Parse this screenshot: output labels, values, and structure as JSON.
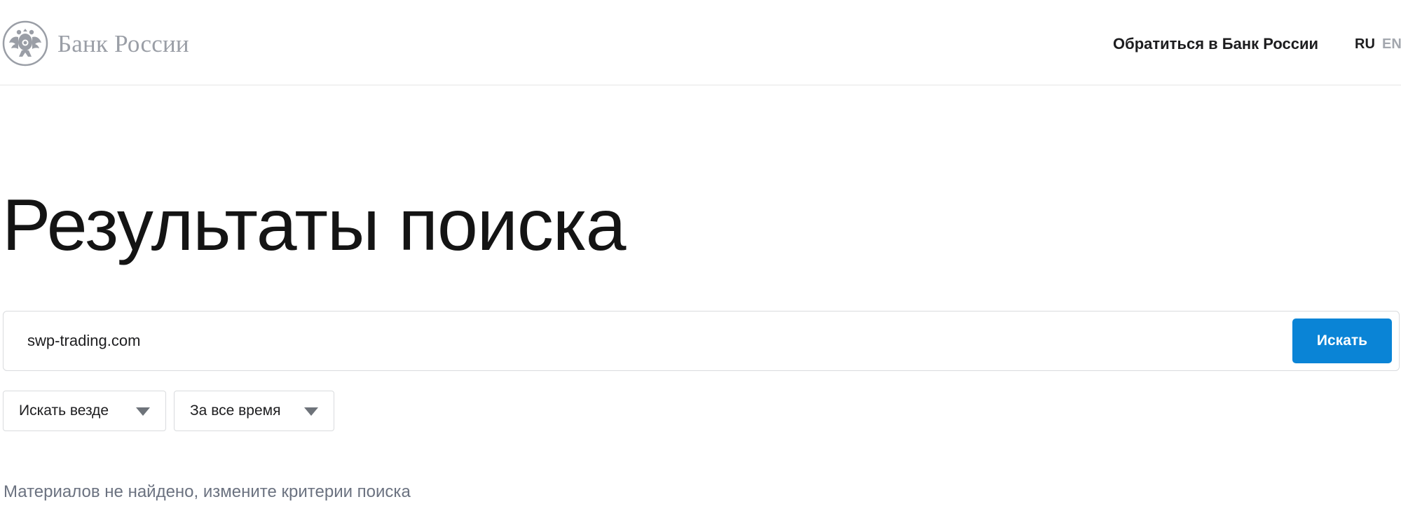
{
  "header": {
    "logo_text": "Банк России",
    "contact_label": "Обратиться в Банк России",
    "lang_ru": "RU",
    "lang_en": "EN"
  },
  "main": {
    "title": "Результаты поиска",
    "search": {
      "value": "swp-trading.com",
      "button_label": "Искать"
    },
    "filters": {
      "where": "Искать везде",
      "time": "За все время"
    },
    "empty_message": "Материалов не найдено, измените критерии поиска"
  },
  "colors": {
    "accent": "#0a84d6",
    "logo_gray": "#9a9ea6",
    "muted_text": "#6b7280"
  },
  "icons": {
    "logo": "double-headed-eagle-emblem",
    "filter_caret": "caret-down-icon"
  }
}
